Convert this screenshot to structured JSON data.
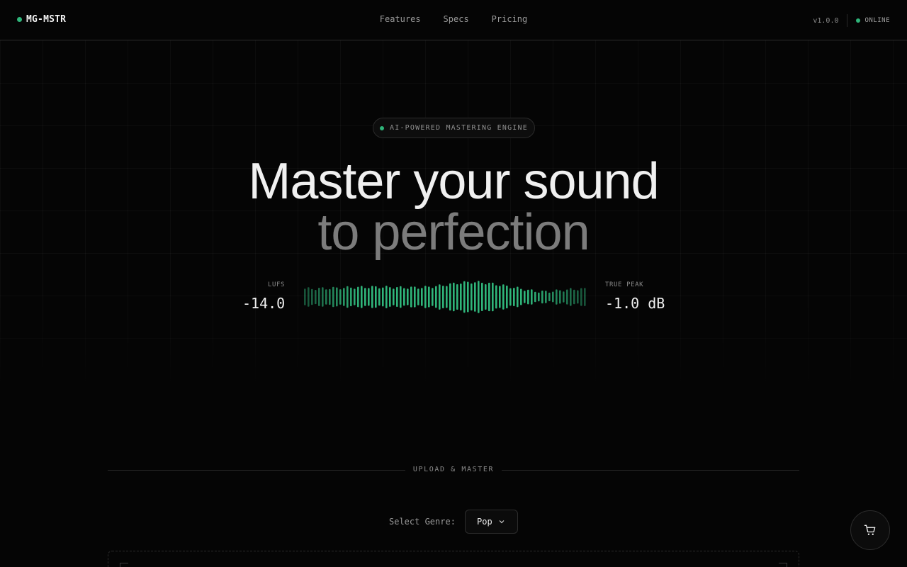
{
  "header": {
    "logo": "MG-MSTR",
    "nav": [
      "Features",
      "Specs",
      "Pricing"
    ],
    "version": "v1.0.0",
    "status": "ONLINE"
  },
  "hero": {
    "badge": "AI-POWERED MASTERING ENGINE",
    "title_line1": "Master your sound",
    "title_line2": "to perfection",
    "lufs_label": "LUFS",
    "lufs_value": "-14.0",
    "peak_label": "TRUE PEAK",
    "peak_value": "-1.0 dB"
  },
  "upload": {
    "section_title": "UPLOAD & MASTER",
    "genre_label": "Select Genre:",
    "genre_value": "Pop"
  },
  "colors": {
    "accent": "#2fb57a",
    "background": "#050505"
  },
  "icons": {
    "cart": "cart-icon",
    "dropdown": "chevron-down-icon"
  }
}
